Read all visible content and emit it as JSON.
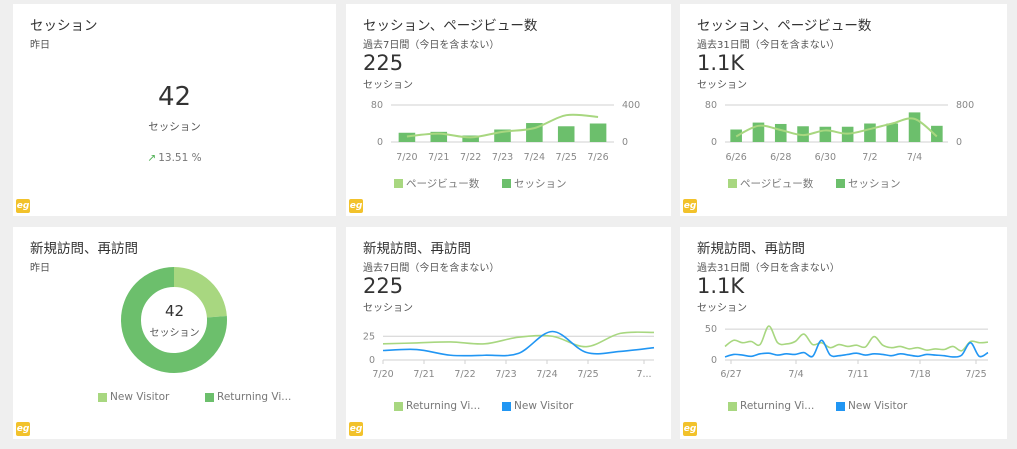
{
  "colors": {
    "light_green": "#a8d780",
    "green": "#6cbf6c",
    "blue": "#2196f3",
    "grid": "#d0d0d0",
    "axis_text": "#888888",
    "logo": "#f2c22b"
  },
  "logo_icon": "eg",
  "card1": {
    "title": "セッション",
    "subtitle": "昨日",
    "value": "42",
    "value_label": "セッション",
    "delta_icon": "arrow-up-right-icon",
    "delta": "13.51 %"
  },
  "card2": {
    "title": "セッション、ページビュー数",
    "subtitle": "過去7日間（今日を含まない）",
    "value": "225",
    "value_label": "セッション",
    "legend": [
      "ページビュー数",
      "セッション"
    ]
  },
  "card3": {
    "title": "セッション、ページビュー数",
    "subtitle": "過去31日間（今日を含まない）",
    "value": "1.1K",
    "value_label": "セッション",
    "legend": [
      "ページビュー数",
      "セッション"
    ]
  },
  "card4": {
    "title": "新規訪問、再訪問",
    "subtitle": "昨日",
    "center_value": "42",
    "center_label": "セッション",
    "legend": [
      "New Visitor",
      "Returning Vi..."
    ]
  },
  "card5": {
    "title": "新規訪問、再訪問",
    "subtitle": "過去7日間（今日を含まない）",
    "value": "225",
    "value_label": "セッション",
    "legend": [
      "Returning Vi...",
      "New Visitor"
    ]
  },
  "card6": {
    "title": "新規訪問、再訪問",
    "subtitle": "過去31日間（今日を含まない）",
    "value": "1.1K",
    "value_label": "セッション",
    "legend": [
      "Returning Vi...",
      "New Visitor"
    ]
  },
  "chart_data": [
    {
      "type": "bar",
      "x_tick_labels": [
        "7/20",
        "7/21",
        "7/22",
        "7/23",
        "7/24",
        "7/25",
        "7/26"
      ],
      "left_ticks": [
        "80",
        "0"
      ],
      "right_ticks": [
        "400",
        "0"
      ],
      "ylim_left": [
        0,
        80
      ],
      "ylim_right": [
        0,
        400
      ],
      "series": [
        {
          "name": "ページビュー数",
          "kind": "line",
          "axis": "right",
          "values": [
            60,
            90,
            50,
            110,
            150,
            290,
            270
          ]
        },
        {
          "name": "セッション",
          "kind": "bar",
          "axis": "left",
          "values": [
            20,
            22,
            14,
            27,
            41,
            34,
            40
          ]
        }
      ]
    },
    {
      "type": "bar",
      "x_tick_labels": [
        "6/26",
        "6/28",
        "6/30",
        "7/2",
        "7/4"
      ],
      "left_ticks": [
        "80",
        "0"
      ],
      "right_ticks": [
        "800",
        "0"
      ],
      "ylim_left": [
        0,
        80
      ],
      "ylim_right": [
        0,
        800
      ],
      "series": [
        {
          "name": "ページビュー数",
          "kind": "line",
          "axis": "right",
          "values": [
            120,
            350,
            260,
            150,
            250,
            180,
            280,
            400,
            500,
            120
          ]
        },
        {
          "name": "セッション",
          "kind": "bar",
          "axis": "left",
          "values": [
            27,
            42,
            39,
            34,
            33,
            33,
            40,
            40,
            64,
            35
          ]
        }
      ]
    },
    {
      "type": "pie",
      "slices": [
        {
          "name": "New Visitor",
          "value": 10
        },
        {
          "name": "Returning Vi...",
          "value": 32
        }
      ]
    },
    {
      "type": "line",
      "x_tick_labels": [
        "7/20",
        "7/21",
        "7/22",
        "7/23",
        "7/24",
        "7/25",
        "7..."
      ],
      "y_ticks": [
        "25",
        "0"
      ],
      "ylim": [
        0,
        40
      ],
      "series": [
        {
          "name": "Returning Vi...",
          "values": [
            17,
            18,
            19,
            17,
            24,
            25,
            14,
            28,
            29
          ]
        },
        {
          "name": "New Visitor",
          "values": [
            10,
            11,
            5,
            5,
            7,
            30,
            8,
            9,
            13
          ]
        }
      ]
    },
    {
      "type": "line",
      "x_tick_labels": [
        "6/27",
        "7/4",
        "7/11",
        "7/18",
        "7/25"
      ],
      "y_ticks": [
        "50",
        "0"
      ],
      "ylim": [
        0,
        60
      ],
      "series": [
        {
          "name": "Returning Vi...",
          "values": [
            22,
            32,
            28,
            30,
            25,
            55,
            28,
            26,
            30,
            42,
            25,
            28,
            20,
            25,
            22,
            24,
            21,
            38,
            24,
            20,
            22,
            18,
            20,
            16,
            18,
            17,
            22,
            15,
            30,
            28,
            29
          ]
        },
        {
          "name": "New Visitor",
          "values": [
            5,
            9,
            8,
            6,
            10,
            11,
            8,
            10,
            9,
            12,
            6,
            32,
            8,
            7,
            9,
            11,
            8,
            10,
            9,
            7,
            10,
            8,
            6,
            9,
            8,
            7,
            5,
            8,
            28,
            6,
            12
          ]
        }
      ]
    }
  ]
}
